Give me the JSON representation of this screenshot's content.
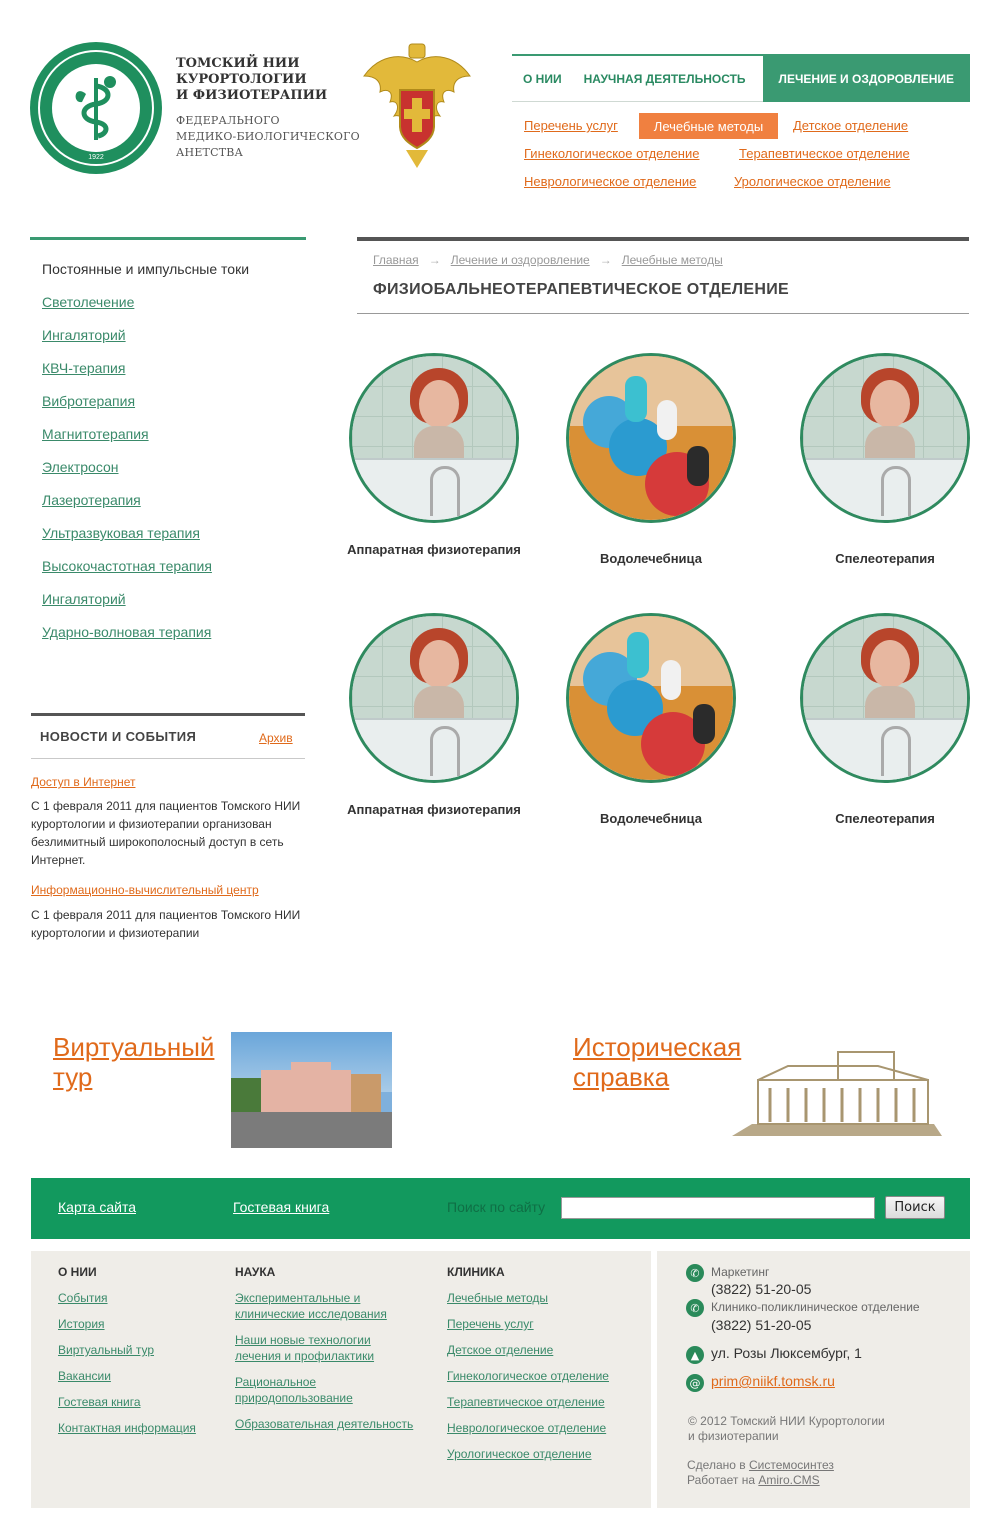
{
  "header": {
    "logo": {
      "seal_year": "1922",
      "seal_text": "ТОМСКИЙ НИИ КУРОРТОЛОГИИ И ФИЗИОТЕРАПИИ"
    },
    "org_title_lines": [
      "ТОМСКИЙ НИИ",
      "КУРОРТОЛОГИИ",
      "И ФИЗИОТЕРАПИИ"
    ],
    "org_sub_lines": [
      "ФЕДЕРАЛЬНОГО",
      "МЕДИКО-БИОЛОГИЧЕСКОГО",
      "АНЕТСТВА"
    ],
    "emblem": "coat-of-arms-icon",
    "nav": [
      "О НИИ",
      "НАУЧНАЯ ДЕЯТЕЛЬНОСТЬ",
      "ЛЕЧЕНИЕ И ОЗДОРОВЛЕНИЕ"
    ],
    "subnav": {
      "services": "Перечень услуг",
      "methods_active": "Лечебные методы",
      "children": "Детское отделение",
      "gyn": "Гинекологическое отделение",
      "therapy": "Терапевтическое отделение",
      "neuro": "Неврологическое отделение",
      "uro": "Урологическое отделение"
    }
  },
  "sidebar": {
    "current": "Постоянные и импульсные токи",
    "items": [
      "Светолечение",
      "Ингаляторий",
      "КВЧ-терапия",
      "Вибротерапия",
      "Магнитотерапия",
      "Электросон",
      "Лазеротерапия",
      "Ультразвуковая терапия",
      "Высокочастотная терапия",
      "Ингаляторий",
      "Ударно-волновая терапия"
    ]
  },
  "news": {
    "title": "НОВОСТИ И СОБЫТИЯ",
    "archive": "Архив",
    "items": [
      {
        "link": "Доступ в Интернет",
        "text": "С 1 февраля 2011 для пациентов Томского НИИ курортологии и физиотерапии организован безлимитный широкополосный доступ в сеть Интернет."
      },
      {
        "link": "Информационно-вычислительный центр",
        "text": "С 1 февраля 2011 для пациентов Томского НИИ курортологии и физиотерапии"
      }
    ]
  },
  "main": {
    "breadcrumbs": [
      "Главная",
      "Лечение и оздоровление",
      "Лечебные методы"
    ],
    "title": "ФИЗИОБАЛЬНЕОТЕРАПЕВТИЧЕСКОЕ ОТДЕЛЕНИЕ",
    "tiles": [
      {
        "label": "Аппаратная физиотерапия",
        "photo": "bath"
      },
      {
        "label": "Водолечебница",
        "photo": "fitball"
      },
      {
        "label": "Спелеотерапия",
        "photo": "bath"
      },
      {
        "label": "Аппаратная физиотерапия",
        "photo": "bath"
      },
      {
        "label": "Водолечебница",
        "photo": "fitball"
      },
      {
        "label": "Спелеотерапия",
        "photo": "bath"
      }
    ]
  },
  "promos": {
    "virtual_tour": "Виртуальный тур",
    "history": "Историческая справка"
  },
  "footer_bar": {
    "sitemap": "Карта сайта",
    "guestbook": "Гостевая книга",
    "search_placeholder": "Поиск по сайту",
    "search_button": "Поиск"
  },
  "footer": {
    "col1": {
      "title": "О НИИ",
      "links": [
        "События",
        "История",
        "Виртуальный тур",
        "Вакансии",
        "Гостевая книга",
        "Контактная информация"
      ]
    },
    "col2": {
      "title": "НАУКА",
      "links": [
        "Экспериментальные и клинические исследования",
        "Наши новые технологии лечения и профилактики",
        "Рациональное природопользование",
        "Образовательная деятельность"
      ]
    },
    "col3": {
      "title": "КЛИНИКА",
      "links": [
        "Лечебные методы",
        "Перечень услуг",
        "Детское отделение",
        "Гинекологическое отделение",
        "Терапевтическое отделение",
        "Неврологическое отделение",
        "Урологическое отделение"
      ]
    },
    "contacts": {
      "marketing_label": "Маркетинг",
      "marketing_phone": "(3822) 51-20-05",
      "clinic_label": "Клинико-поликлиническое отделение",
      "clinic_phone": "(3822) 51-20-05",
      "address": "ул. Розы Люксембург, 1",
      "email": "prim@niikf.tomsk.ru"
    },
    "copyright_lines": [
      "© 2012  Томский НИИ Курортологии",
      "и физиотерапии"
    ],
    "made_prefix": "Сделано в ",
    "made_link": "Системосинтез",
    "powered_prefix": "Работает на ",
    "powered_link": "Amiro.CMS"
  },
  "colors": {
    "brand_green": "#12995e",
    "accent_orange": "#f08040",
    "link_orange": "#e06a1b",
    "link_green": "#3a8a6a"
  }
}
